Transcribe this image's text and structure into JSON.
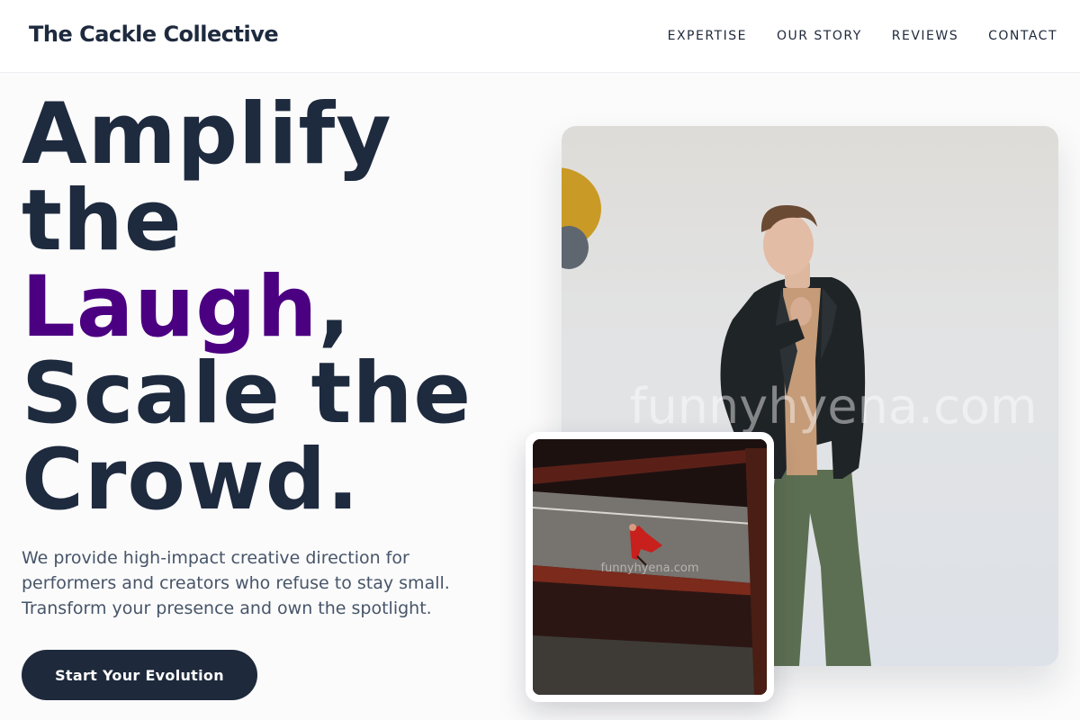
{
  "header": {
    "brand": "The Cackle Collective",
    "nav": [
      "EXPERTISE",
      "OUR STORY",
      "REVIEWS",
      "CONTACT"
    ]
  },
  "hero": {
    "title_lines": [
      "Amplify",
      "the",
      "Laugh",
      ",",
      "Scale the",
      "Crowd."
    ],
    "accent_color": "#4b0082",
    "description_lines": [
      "We provide high-impact creative direction for",
      "performers and creators who refuse to stay small.",
      "Transform your presence and own the spotlight."
    ],
    "cta_label": "Start Your Evolution"
  },
  "images": {
    "main_watermark": "funnyhyena.com",
    "inset_watermark": "funnyhyena.com"
  },
  "colors": {
    "text_dark": "#1e2a3e",
    "body_text": "#475569",
    "button_bg": "#1e293b",
    "background": "#fbfbfb"
  }
}
